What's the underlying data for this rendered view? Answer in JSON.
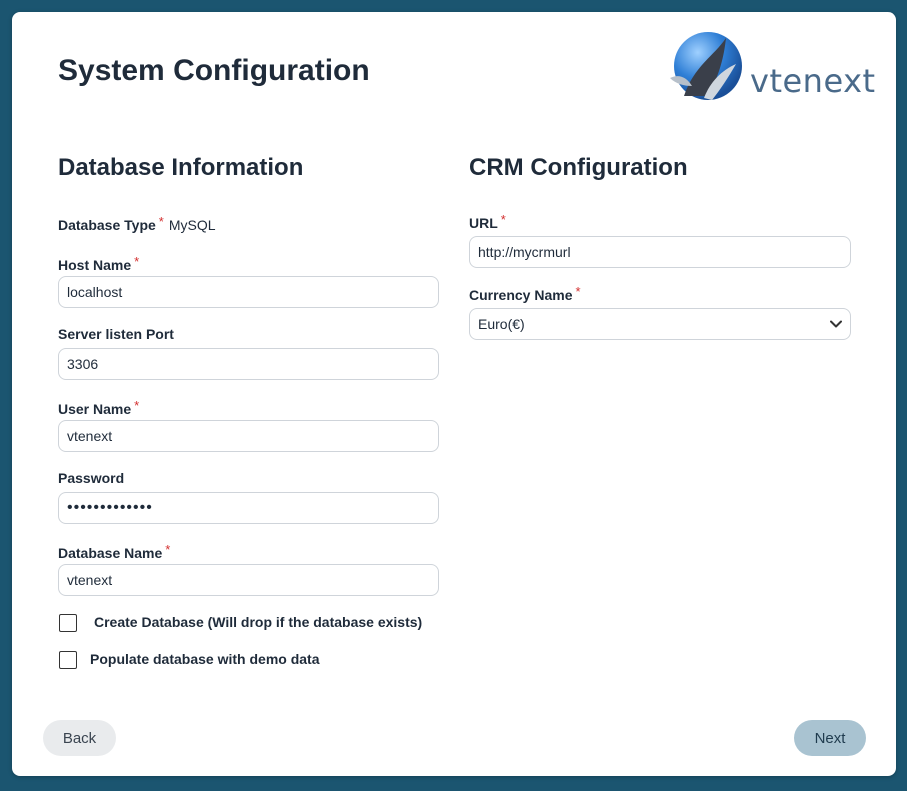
{
  "page": {
    "title": "System Configuration"
  },
  "logo": {
    "text": "vtenext"
  },
  "database": {
    "section_title": "Database Information",
    "db_type_label": "Database Type",
    "db_type_value": "MySQL",
    "host_label": "Host Name",
    "host_value": "localhost",
    "port_label": "Server listen Port",
    "port_value": "3306",
    "user_label": "User Name",
    "user_value": "vtenext",
    "password_label": "Password",
    "password_value": "•••••••••••••",
    "dbname_label": "Database Name",
    "dbname_value": "vtenext",
    "create_db_label": "Create Database (Will drop if the database exists)",
    "demo_data_label": "Populate database with demo data"
  },
  "crm": {
    "section_title": "CRM Configuration",
    "url_label": "URL",
    "url_value": "http://mycrmurl",
    "currency_label": "Currency Name",
    "currency_value": "Euro(€)"
  },
  "required_marker": "*",
  "buttons": {
    "back": "Back",
    "next": "Next"
  },
  "colors": {
    "background": "#1b5570",
    "next_button": "#a9c3d1",
    "required": "#d32f2f"
  }
}
